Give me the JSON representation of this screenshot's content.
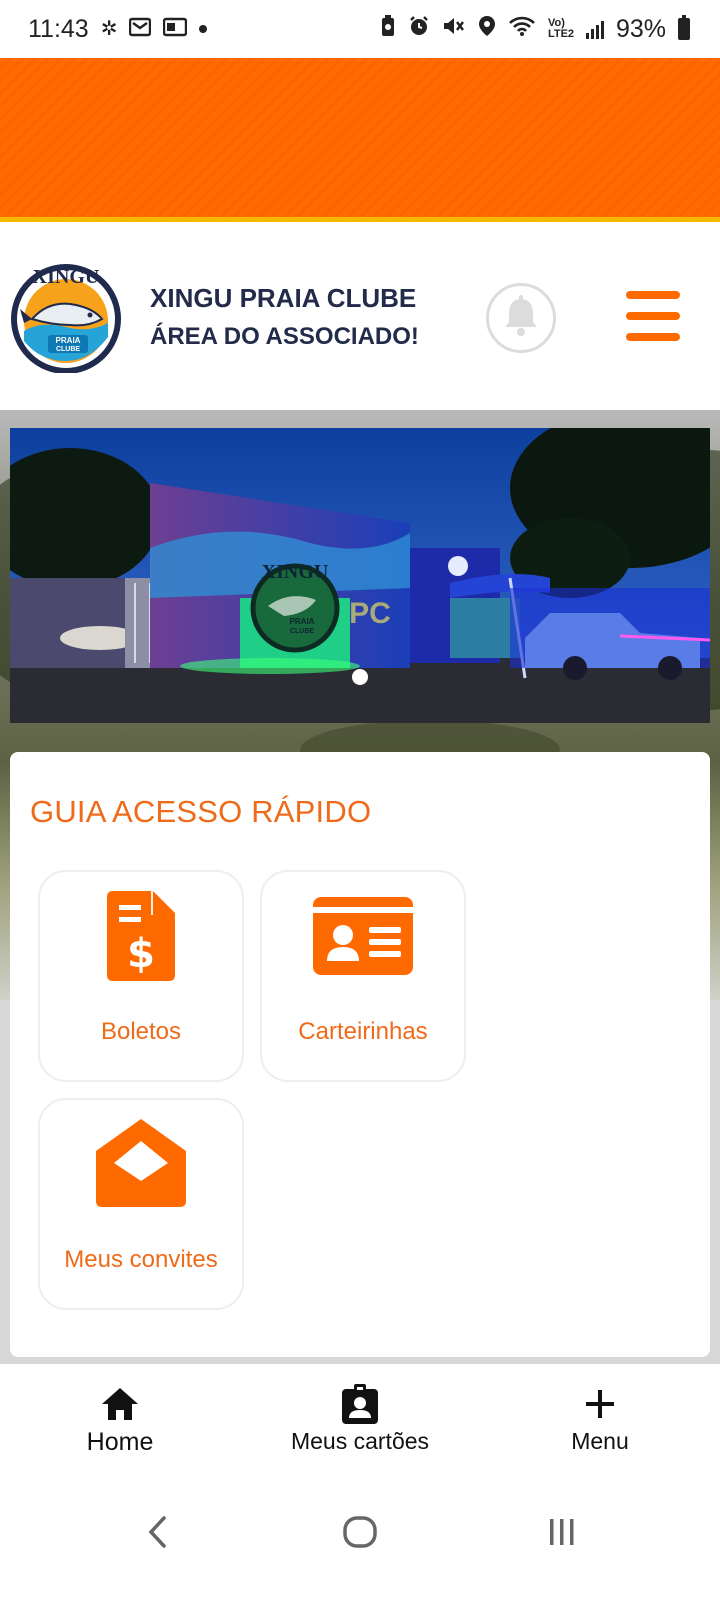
{
  "status_bar": {
    "time": "11:43",
    "battery": "93%",
    "network_label": "Vo) LTE2",
    "left_icons": [
      "pinwheel-icon",
      "gmail-icon",
      "outlook-icon",
      "notification-dot-icon"
    ],
    "right_icons": [
      "battery-saver-icon",
      "alarm-icon",
      "mute-icon",
      "location-icon",
      "wifi-icon",
      "signal-icon",
      "battery-icon"
    ]
  },
  "banner": {
    "color": "#ff6a00",
    "border_color": "#f5b800"
  },
  "header": {
    "title": "XINGU PRAIA CLUBE",
    "subtitle": "ÁREA DO ASSOCIADO!",
    "logo": {
      "top_text": "XINGU",
      "badge_text_1": "PRAIA",
      "badge_text_2": "CLUBE"
    },
    "notification_icon": "bell-icon",
    "menu_icon": "hamburger-icon"
  },
  "carousel": {
    "sign_text": "XINGU",
    "sign_badge_1": "PRAIA",
    "sign_badge_2": "CLUBE",
    "letters": "PC",
    "current_slide": 1,
    "total_slides": 1
  },
  "quick_access": {
    "title": "GUIA ACESSO RÁPIDO",
    "items": [
      {
        "label": "Boletos",
        "icon": "invoice-dollar-icon"
      },
      {
        "label": "Carteirinhas",
        "icon": "id-card-icon"
      },
      {
        "label": "Meus convites",
        "icon": "envelope-open-icon"
      }
    ]
  },
  "bottom_nav": {
    "items": [
      {
        "label": "Home",
        "icon": "home-icon"
      },
      {
        "label": "Meus cartões",
        "icon": "contact-card-icon"
      },
      {
        "label": "Menu",
        "icon": "plus-icon"
      }
    ]
  },
  "system_nav": {
    "buttons": [
      "back-icon",
      "home-circle-icon",
      "recent-apps-icon"
    ]
  },
  "colors": {
    "accent": "#ef6a19",
    "brand_orange": "#ff6a00",
    "navy": "#232b4a"
  }
}
